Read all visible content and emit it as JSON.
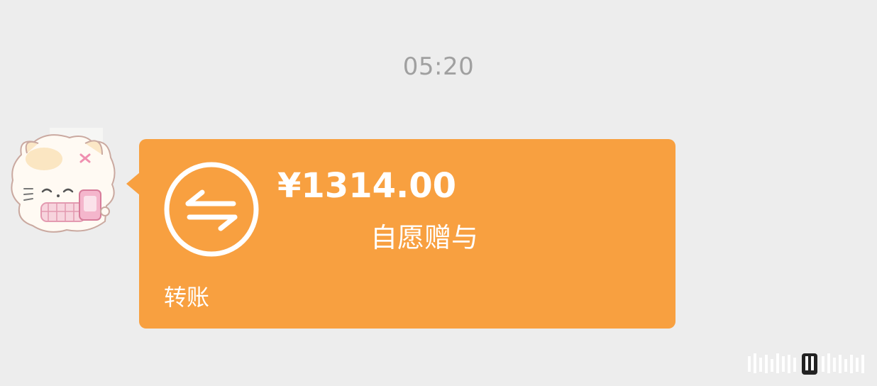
{
  "chat": {
    "timestamp": "05:20"
  },
  "transfer": {
    "amount": "¥1314.00",
    "note": "自愿赠与",
    "label": "转账",
    "bubble_color": "#f8a040",
    "text_color": "#ffffff"
  },
  "icons": {
    "transfer": "transfer-arrows-icon",
    "avatar": "cartoon-cat-avatar"
  },
  "colors": {
    "background": "#ededed",
    "timestamp": "#a0a0a0"
  }
}
